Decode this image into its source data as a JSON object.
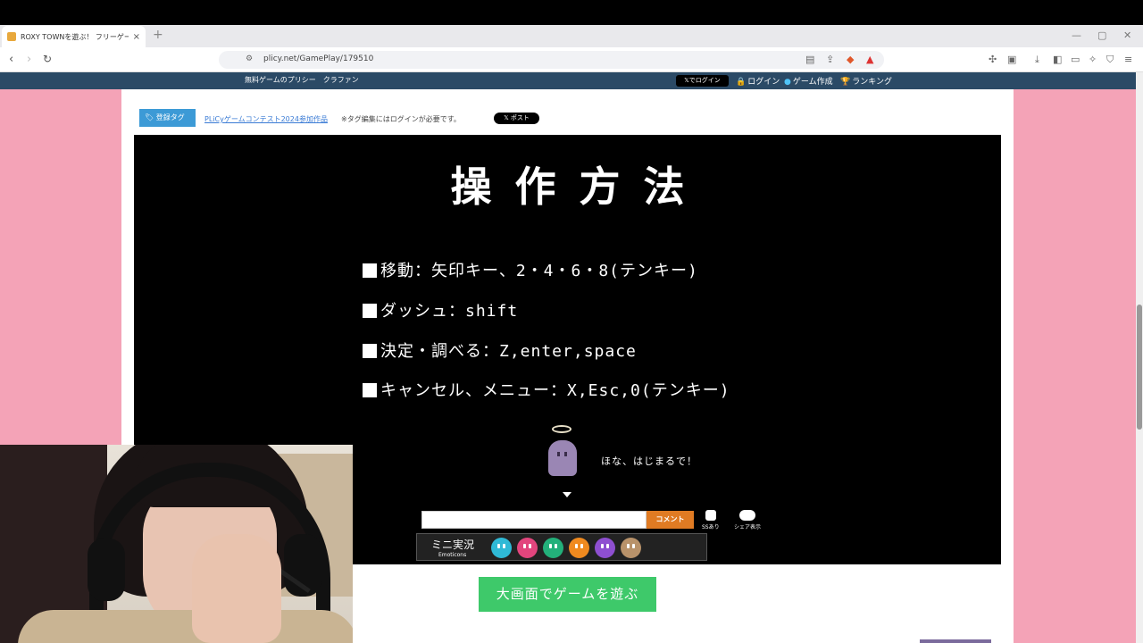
{
  "browser": {
    "tab_title": "ROXY TOWNを遊ぶ！ フリーゲー",
    "tab_close": "×",
    "new_tab": "+",
    "url": "plicy.net/GamePlay/179510",
    "window_controls": [
      "—",
      "▢",
      "✕"
    ]
  },
  "site_bar": {
    "brand": "無料ゲームのプリシー　クラファン",
    "x_login": "𝕏でログイン",
    "login": "ログイン",
    "create_game": "ゲーム作成",
    "ranking": "ランキング"
  },
  "tags": {
    "tag_button": "登録タグ",
    "contest_link": "PLiCyゲームコンテスト2024参加作品",
    "note": "※タグ編集にはログインが必要です。",
    "x_post": "𝕏 ポスト"
  },
  "game": {
    "title": "操作方法",
    "lines": [
      "移動：矢印キー、2・4・6・8(テンキー)",
      "ダッシュ：shift",
      "決定・調べる：Z,enter,space",
      "キャンセル、メニュー：X,Esc,0(テンキー)"
    ],
    "speech": "ほな、はじまるで！"
  },
  "comment": {
    "placeholder": "",
    "button": "コメント",
    "ss_label": "SSあり",
    "share_label": "シェア表示"
  },
  "emoticons": {
    "label": "ミニ実況",
    "sub": "Emoticons",
    "colors": [
      "#2fb9d6",
      "#e2457d",
      "#23b07a",
      "#f08a1f",
      "#8e4fd0",
      "#b8926a"
    ]
  },
  "play_big": "大画面でゲームを遊ぶ",
  "colors": {
    "page_bg": "#f4a3b7",
    "site_bar": "#2b4a66",
    "play_button": "#3ec96a",
    "comment_button": "#e07b23",
    "tag_button": "#3c9ad6"
  }
}
